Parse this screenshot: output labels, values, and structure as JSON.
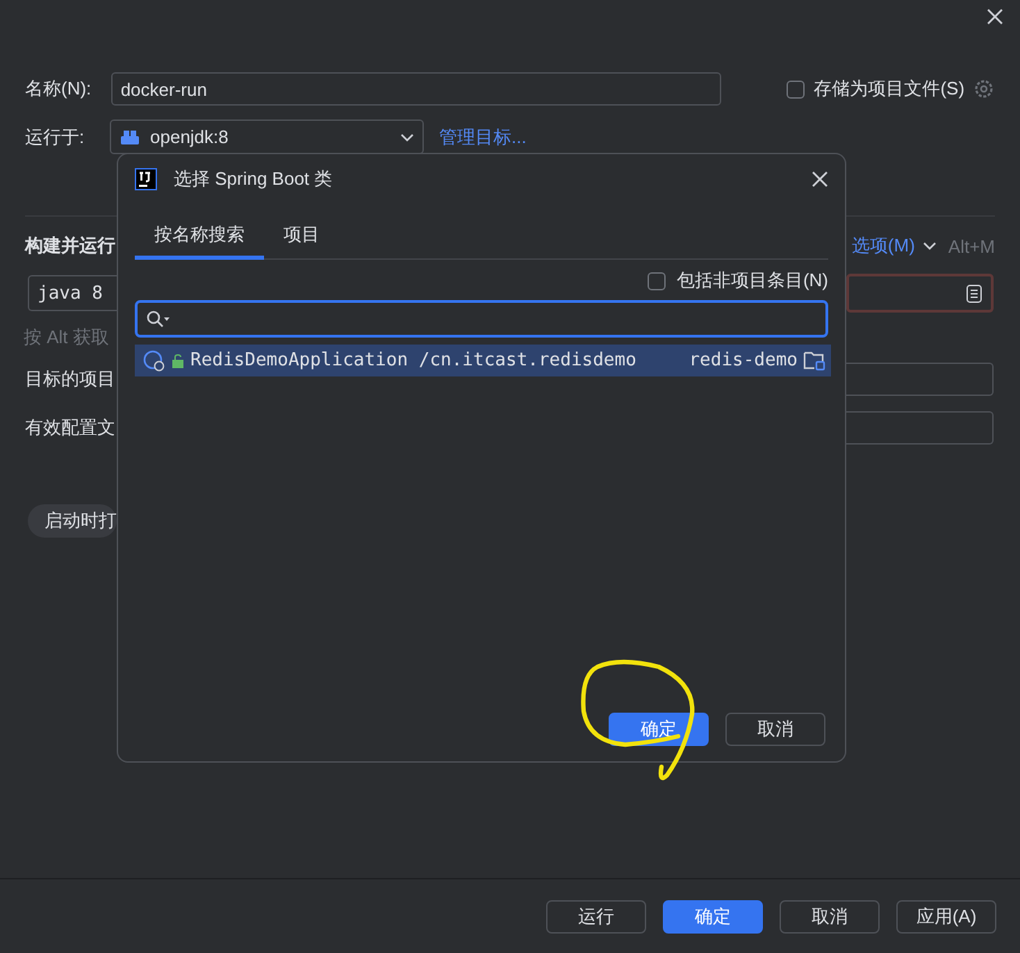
{
  "form": {
    "name_label": "名称(N):",
    "name_value": "docker-run",
    "store_checkbox": {
      "label": "存储为项目文件(S)",
      "checked": false
    },
    "run_on_label": "运行于:",
    "run_on_value": "openjdk:8",
    "manage_link": "管理目标...",
    "build_label": "构建并运行",
    "modify_options": "选项(M)",
    "modify_shortcut": "Alt+M",
    "java_value": "java 8",
    "hint": "按 Alt 获取",
    "target_label": "目标的项目",
    "profiles_label": "有效配置文",
    "startup_chip": "启动时打"
  },
  "buttons": [
    {
      "label": "运行",
      "primary": false
    },
    {
      "label": "确定",
      "primary": true
    },
    {
      "label": "取消",
      "primary": false
    },
    {
      "label": "应用(A)",
      "primary": false
    }
  ],
  "dialog": {
    "title": "选择 Spring Boot 类",
    "tabs": [
      {
        "label": "按名称搜索",
        "selected": true
      },
      {
        "label": "项目",
        "selected": false
      }
    ],
    "include_checkbox": {
      "label": "包括非项目条目(N)",
      "checked": false
    },
    "results": [
      {
        "class_name": "RedisDemoApplication",
        "package": "/cn.itcast.redisdemo",
        "module": "redis-demo",
        "selected": true
      }
    ],
    "buttons": [
      {
        "label": "确定",
        "primary": true
      },
      {
        "label": "取消",
        "primary": false
      }
    ]
  }
}
